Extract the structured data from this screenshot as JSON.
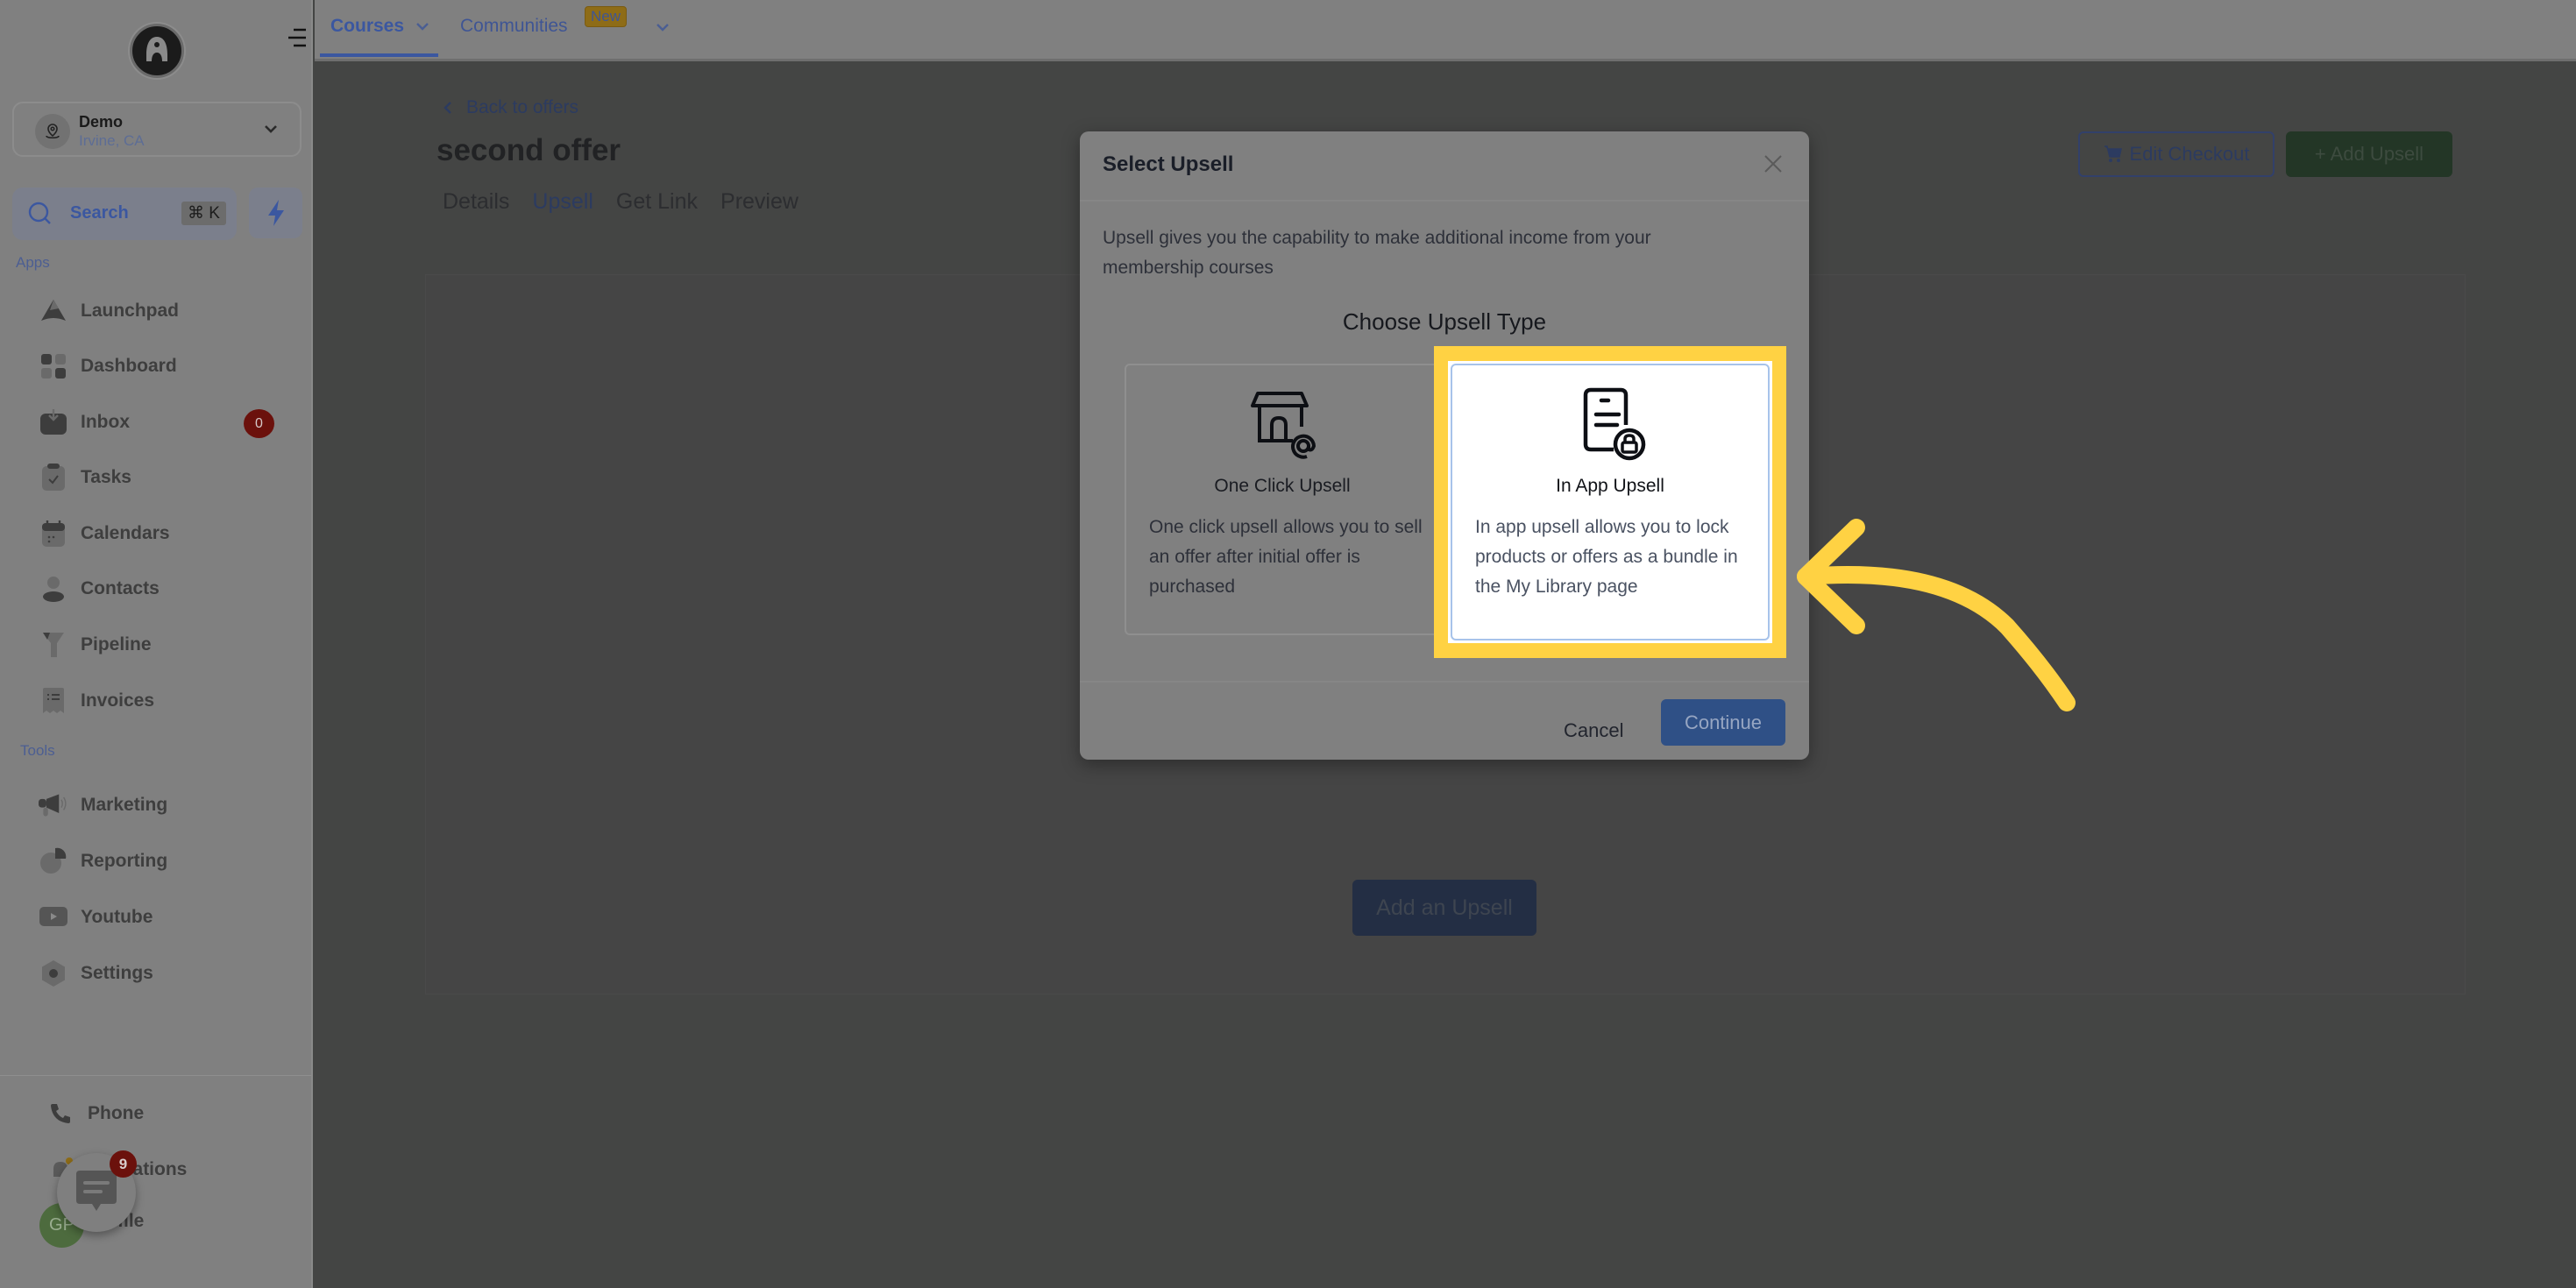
{
  "sidebar": {
    "account": {
      "name": "Demo",
      "location": "Irvine, CA"
    },
    "search": {
      "label": "Search",
      "shortcut": "⌘ K"
    },
    "sections": {
      "apps": "Apps",
      "tools": "Tools"
    },
    "apps": [
      {
        "label": "Launchpad",
        "icon": "launchpad-icon"
      },
      {
        "label": "Dashboard",
        "icon": "dashboard-icon"
      },
      {
        "label": "Inbox",
        "icon": "inbox-icon",
        "badge": "0"
      },
      {
        "label": "Tasks",
        "icon": "tasks-icon"
      },
      {
        "label": "Calendars",
        "icon": "calendar-icon"
      },
      {
        "label": "Contacts",
        "icon": "contacts-icon"
      },
      {
        "label": "Pipeline",
        "icon": "pipeline-icon"
      },
      {
        "label": "Invoices",
        "icon": "invoices-icon"
      }
    ],
    "tools": [
      {
        "label": "Marketing",
        "icon": "megaphone-icon"
      },
      {
        "label": "Reporting",
        "icon": "reporting-icon"
      },
      {
        "label": "Youtube",
        "icon": "youtube-icon"
      },
      {
        "label": "Settings",
        "icon": "settings-icon"
      }
    ],
    "bottom": [
      {
        "label": "Phone",
        "icon": "phone-icon"
      },
      {
        "label": "Notifications",
        "visible_text": "ications",
        "icon": "bell-icon"
      },
      {
        "label": "Profile",
        "visible_text": "file",
        "icon": "avatar"
      }
    ],
    "chat_badge": "9",
    "avatar_initials": "GP"
  },
  "topbar": {
    "tabs": [
      {
        "label": "Courses",
        "active": true
      },
      {
        "label": "Communities",
        "badge": "New"
      }
    ]
  },
  "page": {
    "back_label": "Back to offers",
    "title": "second offer",
    "tabs": [
      "Details",
      "Upsell",
      "Get Link",
      "Preview"
    ],
    "active_tab": "Upsell",
    "edit_checkout_label": "Edit Checkout",
    "add_upsell_label": "+ Add Upsell",
    "add_an_upsell_label": "Add an Upsell"
  },
  "modal": {
    "title": "Select Upsell",
    "description": "Upsell gives you the capability to make additional income from your membership courses",
    "choose_title": "Choose Upsell Type",
    "options": [
      {
        "name": "One Click Upsell",
        "description": "One click upsell allows you to sell an offer after initial offer is purchased",
        "selected": false
      },
      {
        "name": "In App Upsell",
        "description": "In app upsell allows you to lock products or offers as a bundle in the My Library page",
        "selected": true
      }
    ],
    "cancel_label": "Cancel",
    "continue_label": "Continue"
  },
  "colors": {
    "highlight": "#ffd243",
    "primary": "#3b57a0",
    "success": "#233626",
    "danger": "#6b110c"
  }
}
